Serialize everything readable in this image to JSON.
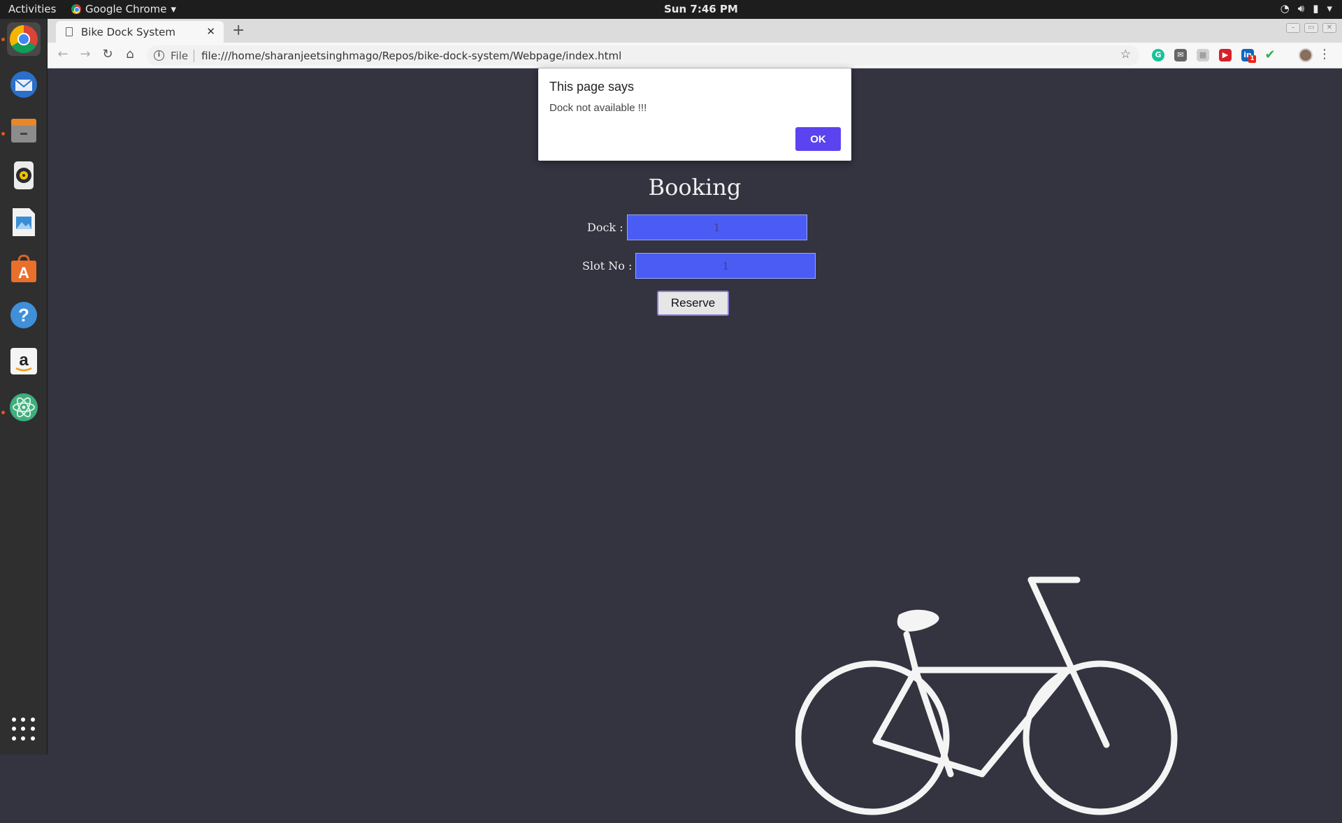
{
  "topbar": {
    "activities": "Activities",
    "app_name": "Google Chrome",
    "clock": "Sun  7:46 PM"
  },
  "dock": {
    "items": [
      "Google Chrome",
      "Thunderbird",
      "Files",
      "Rhythmbox",
      "LibreOffice Impress",
      "Ubuntu Software",
      "Help",
      "Amazon",
      "Atom"
    ],
    "show_apps": "Show Applications"
  },
  "browser": {
    "tab_title": "Bike Dock System",
    "new_tab": "+",
    "scheme_label": "File",
    "url": "file:///home/sharanjeetsinghmago/Repos/bike-dock-system/Webpage/index.html",
    "extension_badge": "1"
  },
  "page": {
    "title": "Booking",
    "dock_label": "Dock :",
    "dock_value": "1",
    "slot_label": "Slot No :",
    "slot_value": "1",
    "reserve_label": "Reserve"
  },
  "alert": {
    "title": "This page says",
    "message": "Dock not available !!!",
    "ok_label": "OK"
  },
  "colors": {
    "page_bg": "#343340",
    "input_bg": "#4a5cf4",
    "alert_ok": "#5b43f0"
  }
}
